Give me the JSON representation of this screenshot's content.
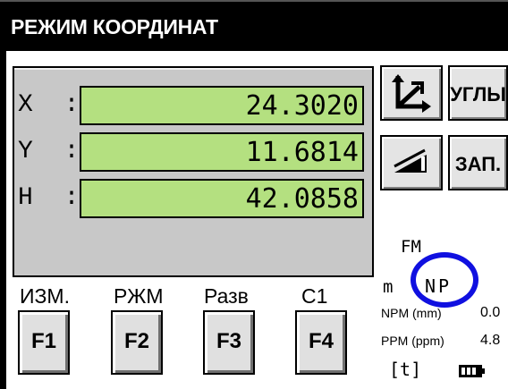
{
  "title": "РЕЖИМ КООРДИНАТ",
  "coords": [
    {
      "label": "X",
      "sep": ":",
      "value": "24.3020"
    },
    {
      "label": "Y",
      "sep": ":",
      "value": "11.6814"
    },
    {
      "label": "H",
      "sep": ":",
      "value": "42.0858"
    }
  ],
  "side_buttons": {
    "angles_label": "УГЛЫ",
    "record_label": "ЗАП."
  },
  "fkeys": [
    {
      "caption": "ИЗМ.",
      "key": "F1"
    },
    {
      "caption": "РЖМ",
      "key": "F2"
    },
    {
      "caption": "Разв",
      "key": "F3"
    },
    {
      "caption": "C1",
      "key": "F4"
    }
  ],
  "status": {
    "fm": "FM",
    "unit": "m",
    "prism": "NP",
    "npm_label": "NPM (mm)",
    "npm_value": "0.0",
    "ppm_label": "PPM (ppm)",
    "ppm_value": "4.8",
    "tilt": "[t]"
  },
  "colors": {
    "field_bg": "#b4e080",
    "panel_bg": "#c8c8c8",
    "annotation_circle": "#1010e0"
  },
  "icons": [
    "coordinate-axes-icon",
    "prism-target-icon",
    "battery-icon"
  ]
}
